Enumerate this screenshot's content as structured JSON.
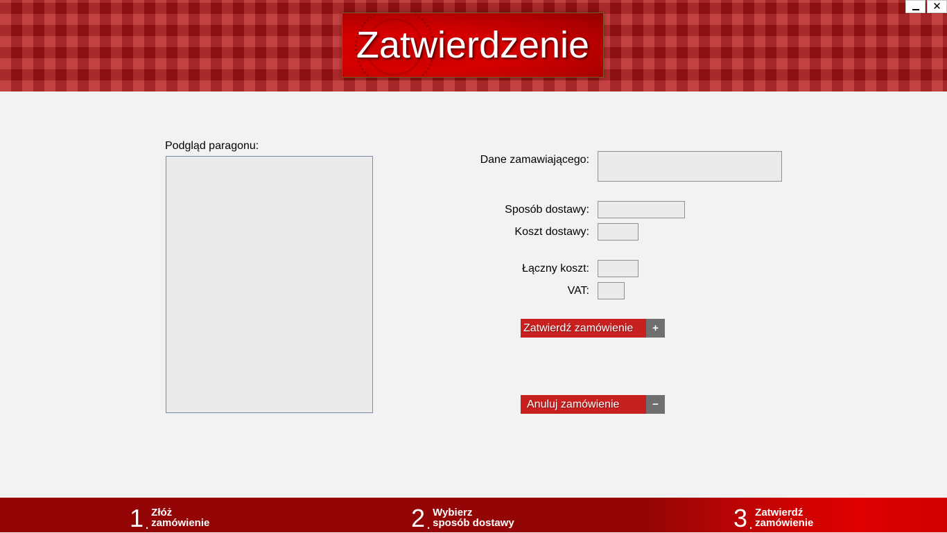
{
  "window": {
    "title": "Zatwierdzenie",
    "minimize_label": "",
    "close_label": "✕"
  },
  "receipt": {
    "label": "Podgląd paragonu:"
  },
  "form": {
    "customer_label": "Dane zamawiającego:",
    "delivery_method_label": "Sposób dostawy:",
    "delivery_cost_label": "Koszt dostawy:",
    "total_cost_label": "Łączny koszt:",
    "vat_label": "VAT:",
    "customer_value": "",
    "delivery_method_value": "",
    "delivery_cost_value": "",
    "total_cost_value": "",
    "vat_value": ""
  },
  "actions": {
    "confirm_label": "Zatwierdź zamówienie",
    "confirm_icon": "+",
    "cancel_label": "Anuluj zamówienie",
    "cancel_icon": "−"
  },
  "steps": [
    {
      "number": "1",
      "line1": "Złóż",
      "line2": "zamówienie",
      "active": false
    },
    {
      "number": "2",
      "line1": "Wybierz",
      "line2": "sposób dostawy",
      "active": false
    },
    {
      "number": "3",
      "line1": "Zatwierdź",
      "line2": "zamówienie",
      "active": true
    }
  ],
  "colors": {
    "brand_red": "#c8201f",
    "footer_red": "#940505",
    "active_step_red": "#e00000",
    "icon_gray": "#6f6f6f",
    "field_bg": "#ebebeb"
  }
}
